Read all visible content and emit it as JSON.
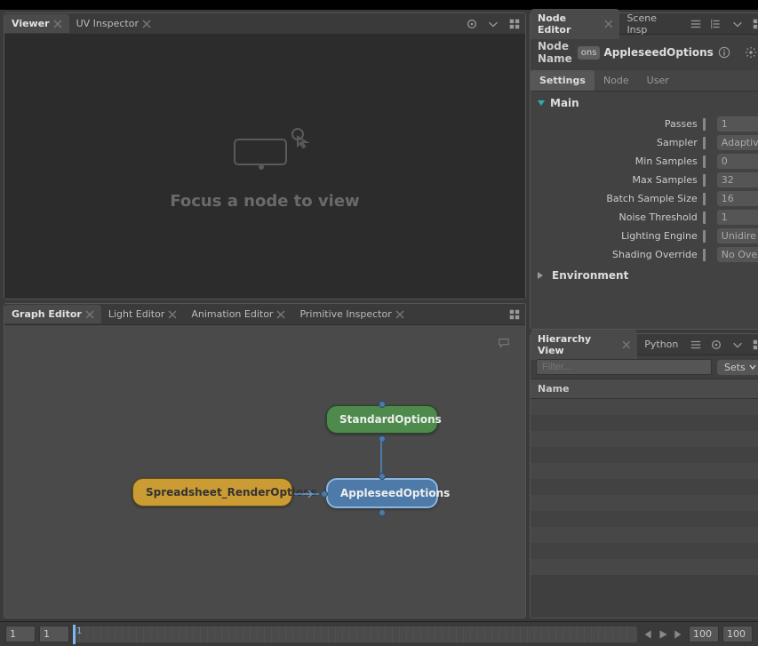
{
  "left_tabs_top": [
    {
      "label": "Viewer",
      "active": true
    },
    {
      "label": "UV Inspector",
      "active": false
    }
  ],
  "viewer": {
    "placeholder_msg": "Focus a node to view"
  },
  "left_tabs_bottom": [
    {
      "label": "Graph Editor",
      "active": true
    },
    {
      "label": "Light Editor",
      "active": false
    },
    {
      "label": "Animation Editor",
      "active": false
    },
    {
      "label": "Primitive Inspector",
      "active": false
    }
  ],
  "graph": {
    "nodes": {
      "standard": "StandardOptions",
      "appleseed": "AppleseedOptions",
      "spreadsheet": "Spreadsheet_RenderOptions"
    }
  },
  "right_tabs_top": [
    {
      "label": "Node Editor",
      "active": true
    },
    {
      "label": "Scene Insp",
      "active": false
    }
  ],
  "node_editor": {
    "name_label": "Node Name",
    "name_value_suffix": "ons",
    "name_value": "AppleseedOptions",
    "sub_tabs": [
      {
        "label": "Settings",
        "active": true
      },
      {
        "label": "Node",
        "active": false
      },
      {
        "label": "User",
        "active": false
      }
    ],
    "sections": [
      {
        "title": "Main",
        "open": true,
        "params": [
          {
            "label": "Passes",
            "value": "1"
          },
          {
            "label": "Sampler",
            "value": "Adaptiv"
          },
          {
            "label": "Min Samples",
            "value": "0"
          },
          {
            "label": "Max Samples",
            "value": "32"
          },
          {
            "label": "Batch Sample Size",
            "value": "16"
          },
          {
            "label": "Noise Threshold",
            "value": "1"
          },
          {
            "label": "Lighting Engine",
            "value": "Unidire"
          },
          {
            "label": "Shading Override",
            "value": "No Ove"
          }
        ]
      },
      {
        "title": "Environment",
        "open": false,
        "params": []
      }
    ]
  },
  "right_tabs_bottom": [
    {
      "label": "Hierarchy View",
      "active": true
    },
    {
      "label": "Python",
      "active": false
    }
  ],
  "hierarchy": {
    "filter_placeholder": "Filter...",
    "sets_label": "Sets",
    "header": "Name",
    "empty_rows": 11
  },
  "timeline": {
    "start_outer": "1",
    "start_inner": "1",
    "current": "1",
    "end_inner": "100",
    "end_outer": "100"
  }
}
